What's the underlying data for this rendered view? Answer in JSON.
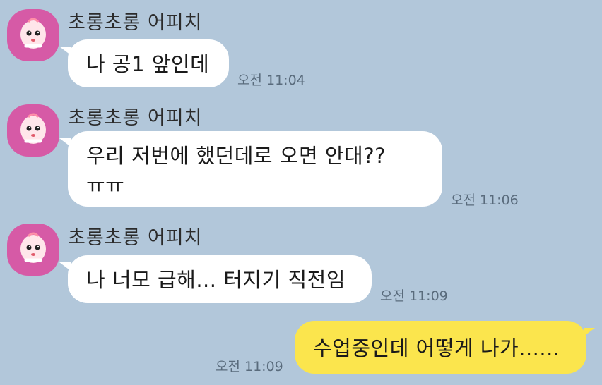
{
  "colors": {
    "background": "#b2c7da",
    "incoming_bubble": "#ffffff",
    "outgoing_bubble": "#fbe54d",
    "avatar_bg": "#d65aa6"
  },
  "messages": [
    {
      "direction": "incoming",
      "sender": "초롱초롱 어피치",
      "avatar_icon": "apeach-avatar-icon",
      "text": "나 공1 앞인데",
      "time": "오전 11:04"
    },
    {
      "direction": "incoming",
      "sender": "초롱초롱 어피치",
      "avatar_icon": "apeach-avatar-icon",
      "text": "우리 저번에 했던데로 오면 안대??\nㅠㅠ",
      "time": "오전 11:06"
    },
    {
      "direction": "incoming",
      "sender": "초롱초롱 어피치",
      "avatar_icon": "apeach-avatar-icon",
      "text": "나 너모 급해... 터지기 직전임",
      "time": "오전 11:09"
    },
    {
      "direction": "outgoing",
      "text": "수업중인데 어떻게 나가......",
      "time": "오전 11:09"
    }
  ]
}
